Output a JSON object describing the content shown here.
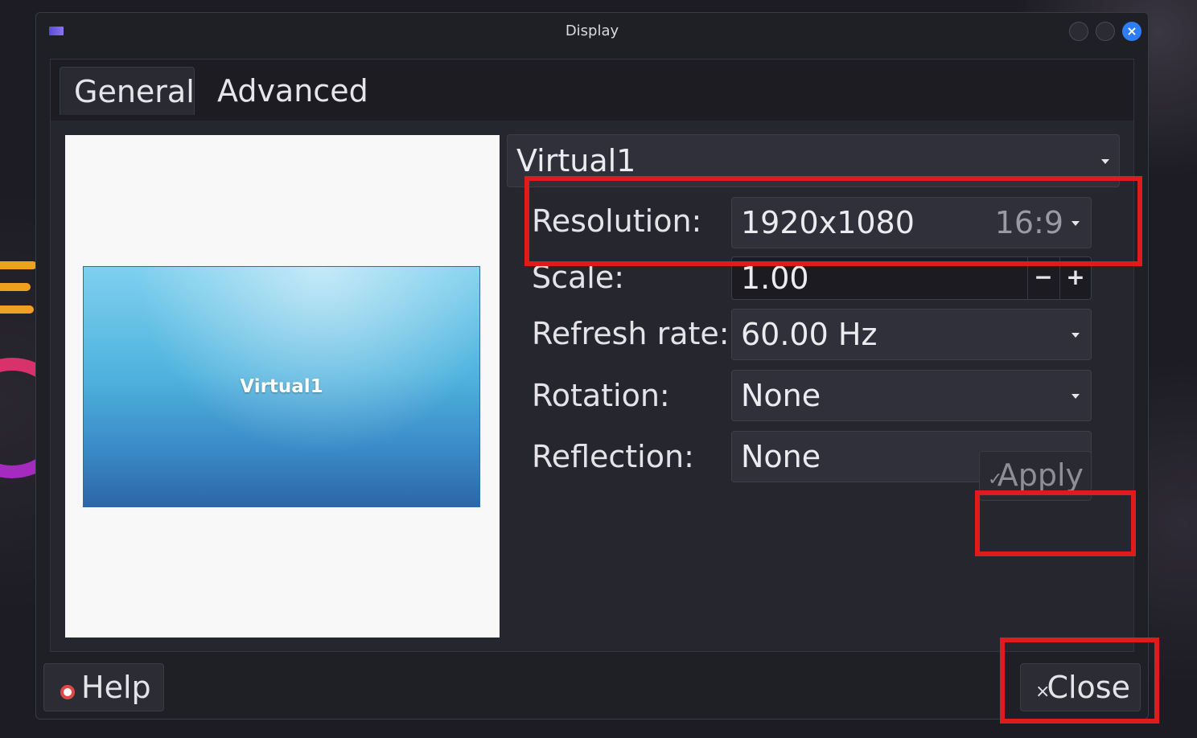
{
  "window": {
    "title": "Display"
  },
  "titlebar_buttons": {
    "close_glyph": "×"
  },
  "tabs": [
    {
      "label": "General",
      "active": true
    },
    {
      "label": "Advanced",
      "active": false
    }
  ],
  "preview": {
    "monitor_label": "Virtual1"
  },
  "display_select": {
    "value": "Virtual1"
  },
  "settings": {
    "resolution": {
      "label": "Resolution:",
      "value": "1920x1080",
      "aspect": "16:9"
    },
    "scale": {
      "label": "Scale:",
      "value": "1.00",
      "minus": "−",
      "plus": "+"
    },
    "refresh_rate": {
      "label": "Refresh rate:",
      "value": "60.00 Hz"
    },
    "rotation": {
      "label": "Rotation:",
      "value": "None"
    },
    "reflection": {
      "label": "Reflection:",
      "value": "None"
    }
  },
  "buttons": {
    "apply": "Apply",
    "apply_icon": "✓",
    "help": "Help",
    "close": "Close",
    "close_icon": "×"
  },
  "colors": {
    "annotation": "#e01b1b",
    "titlebar_close": "#2e7cf6",
    "help_icon": "#e04848"
  }
}
